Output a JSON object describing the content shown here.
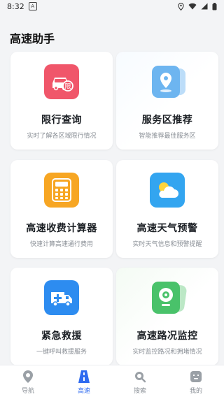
{
  "status_bar": {
    "time": "8:32"
  },
  "page_title": "高速助手",
  "cards": [
    {
      "title": "限行查询",
      "desc": "实时了解各区域限行情况",
      "icon": "restricted-car-icon",
      "color": "#f0566a"
    },
    {
      "title": "服务区推荐",
      "desc": "智能推荐最佳服务区",
      "icon": "location-card-icon",
      "color": "#57a6ec"
    },
    {
      "title": "高速收费计算器",
      "desc": "快速计算高速通行费用",
      "icon": "calculator-icon",
      "color": "#f7a623"
    },
    {
      "title": "高速天气预警",
      "desc": "实时天气信息和预警提醒",
      "icon": "weather-icon",
      "color": "#33a5f0"
    },
    {
      "title": "紧急救援",
      "desc": "一键呼叫救援服务",
      "icon": "ambulance-icon",
      "color": "#2d8cf0"
    },
    {
      "title": "高速路况监控",
      "desc": "实时监控路况和拥堵情况",
      "icon": "camera-icon",
      "color": "#49c26a"
    }
  ],
  "nav": [
    {
      "label": "导航",
      "icon": "map-pin-icon"
    },
    {
      "label": "高速",
      "icon": "highway-icon"
    },
    {
      "label": "搜索",
      "icon": "search-icon"
    },
    {
      "label": "我的",
      "icon": "profile-icon"
    }
  ]
}
